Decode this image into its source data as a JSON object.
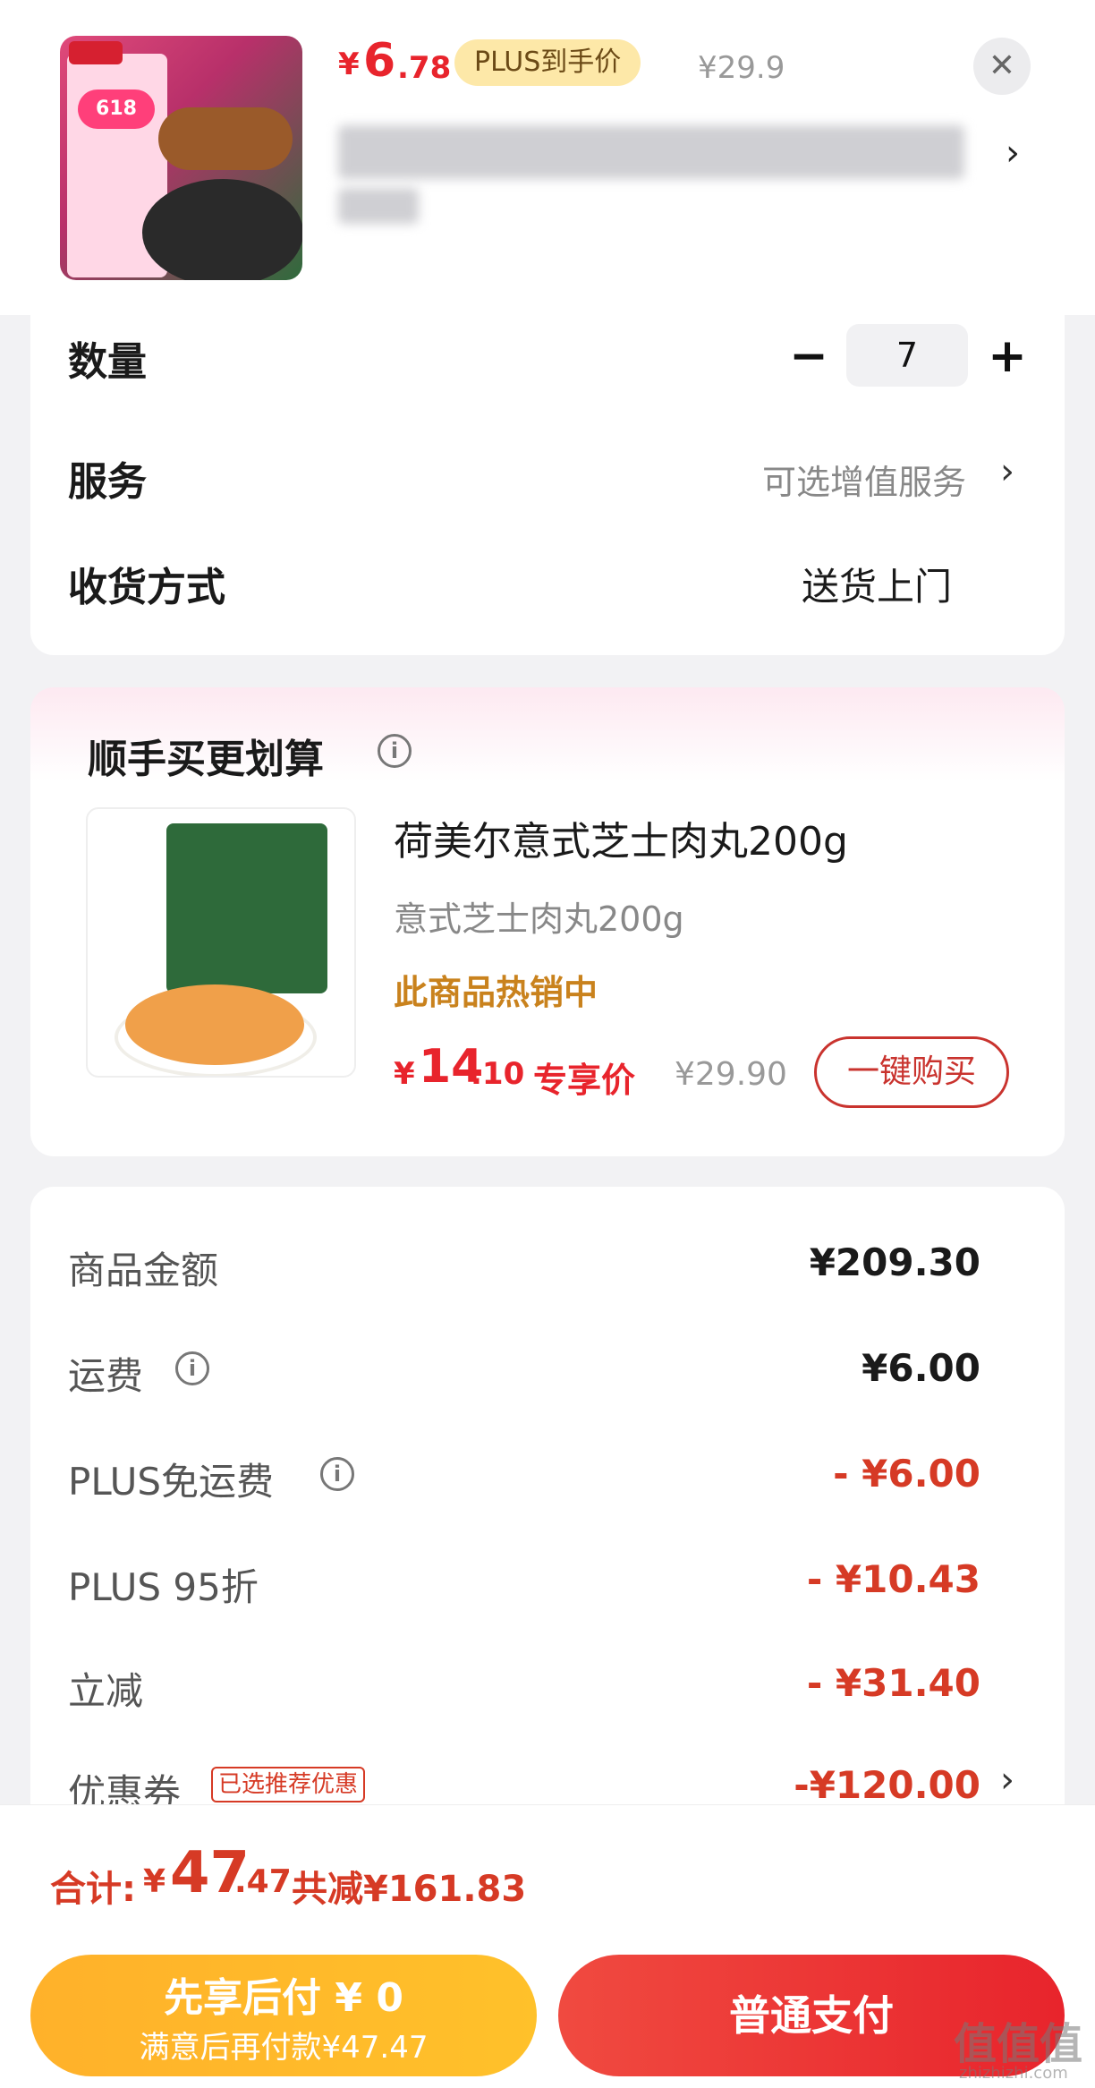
{
  "product": {
    "price_symbol": "¥",
    "price_main": "6",
    "price_decimal": ".78",
    "plus_badge": "PLUS到手价",
    "original_price": "¥29.9",
    "close_icon": "close-icon"
  },
  "settings": {
    "quantity_label": "数量",
    "quantity_value": "7",
    "minus": "−",
    "plus": "+",
    "service_label": "服务",
    "service_value": "可选增值服务",
    "delivery_label": "收货方式",
    "delivery_value": "送货上门"
  },
  "upsell": {
    "title": "顺手买更划算",
    "name": "荷美尔意式芝士肉丸200g",
    "spec": "意式芝士肉丸200g",
    "hot_label": "此商品热销中",
    "price_symbol": "¥",
    "price_main": "14",
    "price_decimal": ".10",
    "price_label": "专享价",
    "original_price": "¥29.90",
    "buy_button": "一键购买"
  },
  "summary": {
    "rows": [
      {
        "label": "商品金额",
        "value": "¥209.30"
      },
      {
        "label": "运费",
        "value": "¥6.00"
      },
      {
        "label": "PLUS免运费",
        "value": "- ¥6.00"
      },
      {
        "label": "PLUS 95折",
        "value": "- ¥10.43"
      },
      {
        "label": "立减",
        "value": "- ¥31.40"
      },
      {
        "label": "优惠券",
        "value": "-¥120.00"
      }
    ],
    "coupon_tag": "已选推荐优惠",
    "info_glyph": "i",
    "chevron": "›"
  },
  "footer": {
    "total_label": "合计:",
    "total_symbol": "¥",
    "total_main": "47",
    "total_decimal": ".47",
    "total_saved": "共减¥161.83",
    "pay_later_main": "先享后付 ¥ 0",
    "pay_later_sub": "满意后再付款¥47.47",
    "pay_button": "普通支付"
  },
  "watermark": {
    "main": "值值值",
    "sub": "zhizhizhi.com"
  },
  "colors": {
    "accent_red": "#e8242c",
    "discount_red": "#d63a25",
    "plus_gold": "#fde8a8",
    "pay_later_yellow": "#ffb12a"
  }
}
